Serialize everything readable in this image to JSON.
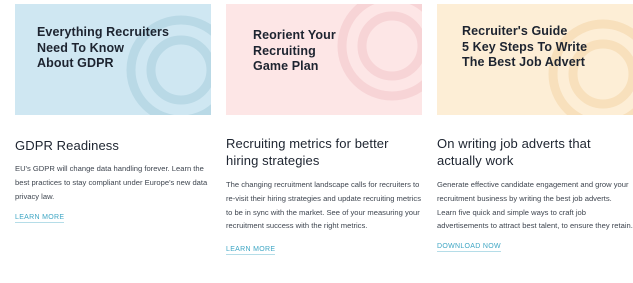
{
  "cards": [
    {
      "banner_title": "Everything Recruiters\nNeed To Know\nAbout GDPR",
      "banner_color": "#cfe7f2",
      "deco_color": "#b9d9e6",
      "title": "GDPR Readiness",
      "description": "EU's GDPR will change data handling forever. Learn the best practices to stay compliant under Europe's new data privacy law.",
      "link": "LEARN MORE"
    },
    {
      "banner_title": "Reorient Your\nRecruiting\nGame Plan",
      "banner_color": "#fde6e6",
      "deco_color": "#f7d4d6",
      "title": "Recruiting metrics for better hiring strategies",
      "description": "The changing recruitment landscape calls for recruiters to re-visit their hiring strategies and update recruiting metrics to be in sync with the market. See of your measuring your recruitment success with the right metrics.",
      "link": "LEARN MORE"
    },
    {
      "banner_title": "Recruiter's Guide\n5 Key Steps To Write\nThe Best Job Advert",
      "banner_color": "#fdeed6",
      "deco_color": "#f8e0bc",
      "title": "On writing job adverts that actually work",
      "description": "Generate effective candidate engagement and grow your recruitment business by writing the best job adverts. Learn five quick and simple ways to craft job advertisements to attract best talent, to ensure they retain.",
      "link": "DOWNLOAD NOW"
    }
  ],
  "colors": {
    "link": "#3ea6c4",
    "heading": "#1d2430"
  }
}
